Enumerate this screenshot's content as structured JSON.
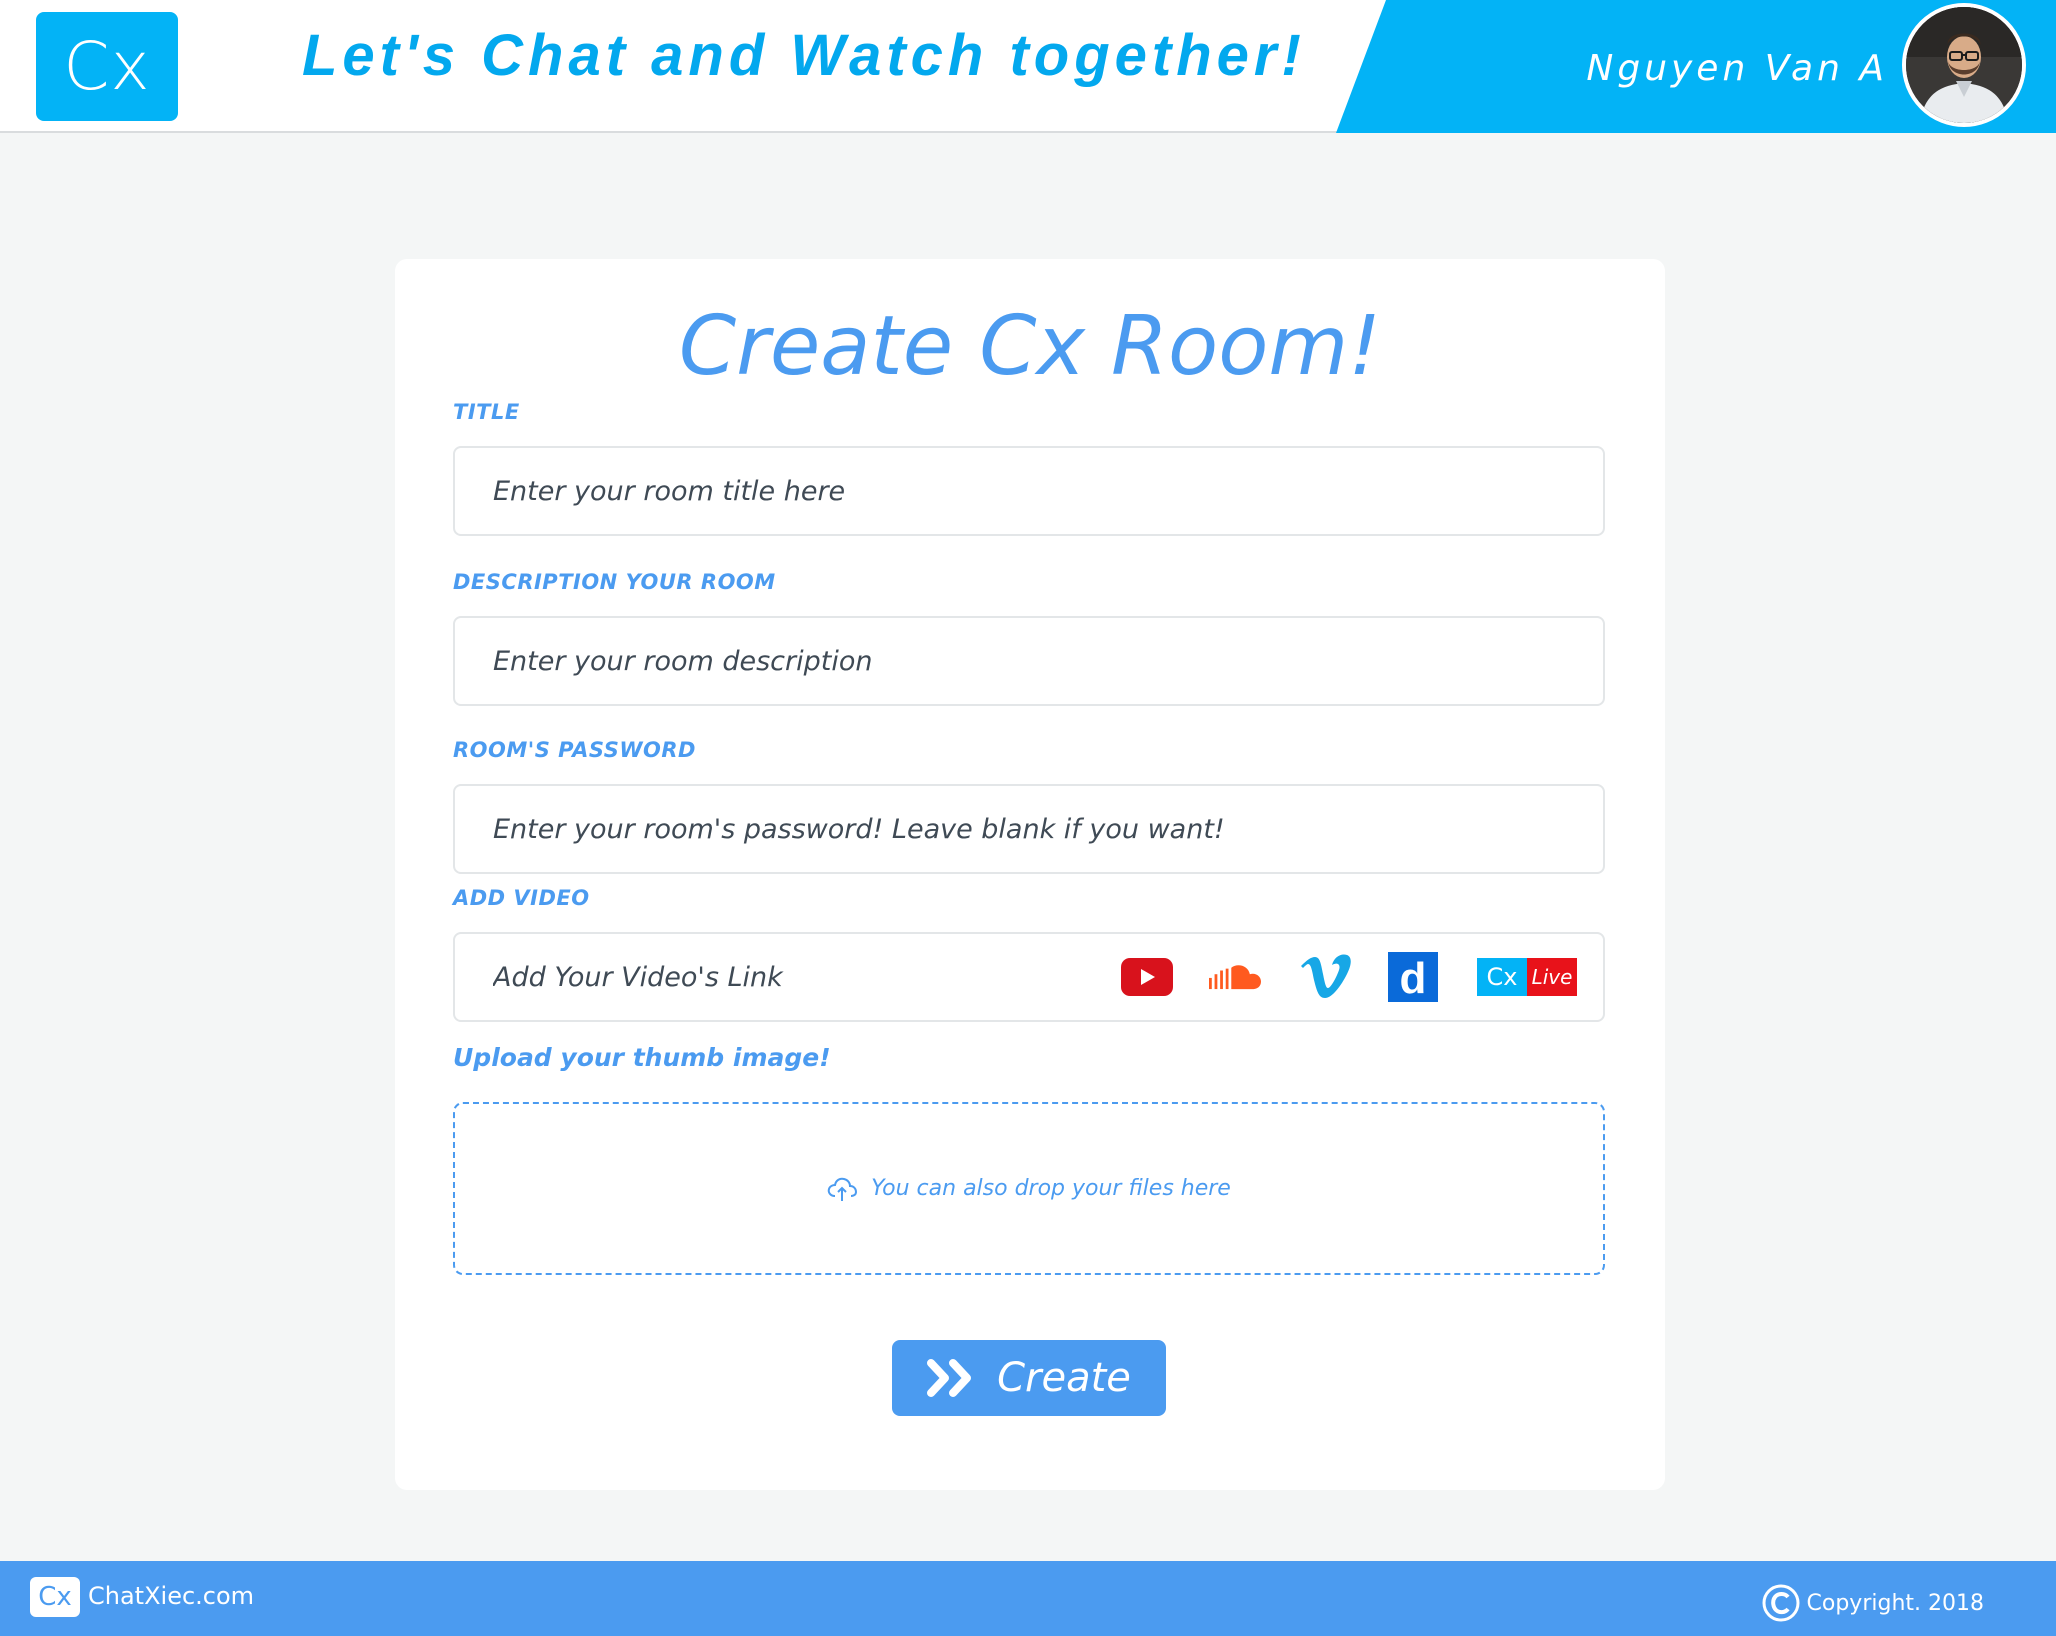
{
  "header": {
    "logo_text": "Cx",
    "tagline": "Let's Chat and Watch together!",
    "user_name": "Nguyen Van A",
    "accent_color": "#03b3f6"
  },
  "form": {
    "title": "Create Cx Room!",
    "title_label": "TITLE",
    "title_placeholder": "Enter your room title here",
    "description_label": "DESCRIPTION YOUR ROOM",
    "description_placeholder": "Enter your room description",
    "password_label": "ROOM'S PASSWORD",
    "password_placeholder": "Enter your room's password! Leave blank if you want!",
    "video_label": "ADD VIDEO",
    "video_placeholder": "Add Your Video's Link",
    "video_sources": [
      {
        "name": "youtube-icon"
      },
      {
        "name": "soundcloud-icon"
      },
      {
        "name": "vimeo-icon"
      },
      {
        "name": "dailymotion-icon",
        "glyph": "d"
      },
      {
        "name": "cx-live-icon",
        "text_left": "Cx",
        "text_right": "Live"
      }
    ],
    "thumb_label": "Upload your thumb image!",
    "drop_text": "You can also drop your files here",
    "create_label": "Create",
    "accent_color": "#4b9bf0"
  },
  "footer": {
    "logo_text": "Cx",
    "site": "ChatXiec.com",
    "copyright": "Copyright. 2018"
  }
}
